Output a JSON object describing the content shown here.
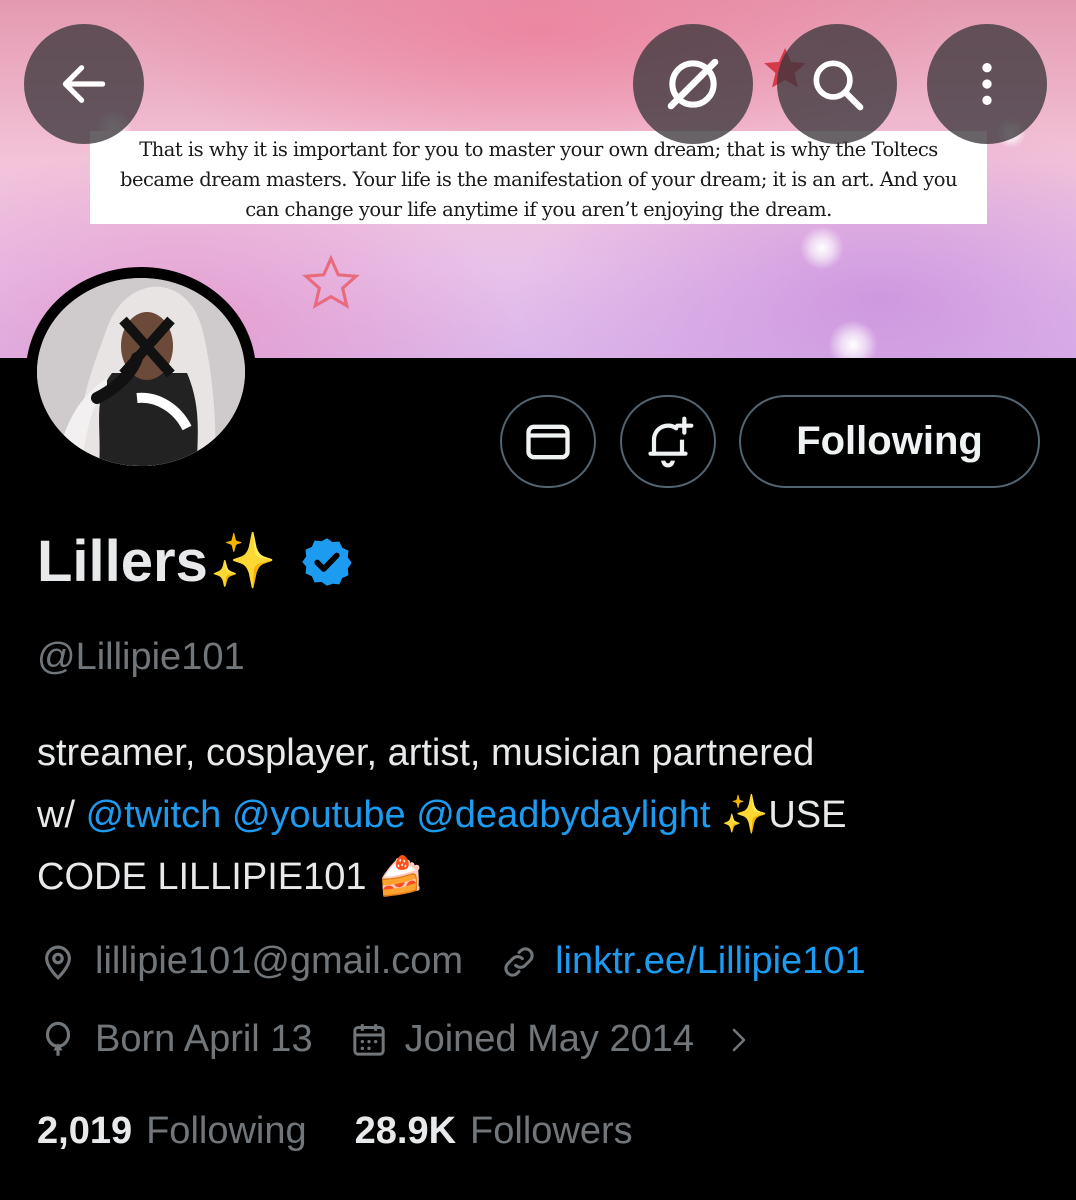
{
  "banner": {
    "quote": "That is why it is important for you to master your own dream; that is why the Toltecs became dream masters. Your life is the manifestation of your dream; it is an art. And you can change your life anytime if you aren’t enjoying the dream."
  },
  "toolbar": {
    "back_icon": "arrow-left-icon",
    "grok_icon": "grok-icon",
    "search_icon": "search-icon",
    "more_icon": "more-vertical-icon"
  },
  "actions": {
    "message_icon": "mail-icon",
    "notify_icon": "bell-plus-icon",
    "following_label": "Following"
  },
  "profile": {
    "display_name": "Lillers",
    "name_emoji": "✨",
    "verified": true,
    "handle": "@Lillipie101",
    "bio": {
      "line1": "streamer, cosplayer, artist, musician partnered",
      "line2_prefix": "w/ ",
      "mention1": "@twitch",
      "mention2": "@youtube",
      "mention3": "@deadbydaylight",
      "line2_suffix": " ✨USE",
      "line3": "CODE LILLIPIE101 🍰"
    },
    "location": "lillipie101@gmail.com",
    "website": "linktr.ee/Lillipie101",
    "birthday": "Born April 13",
    "joined": "Joined May 2014"
  },
  "stats": {
    "following_count": "2,019",
    "following_label": "Following",
    "followers_count": "28.9K",
    "followers_label": "Followers"
  },
  "colors": {
    "accent": "#1d9bf0",
    "secondary_text": "#71767b",
    "primary_text": "#e7e9ea",
    "background": "#000000"
  }
}
